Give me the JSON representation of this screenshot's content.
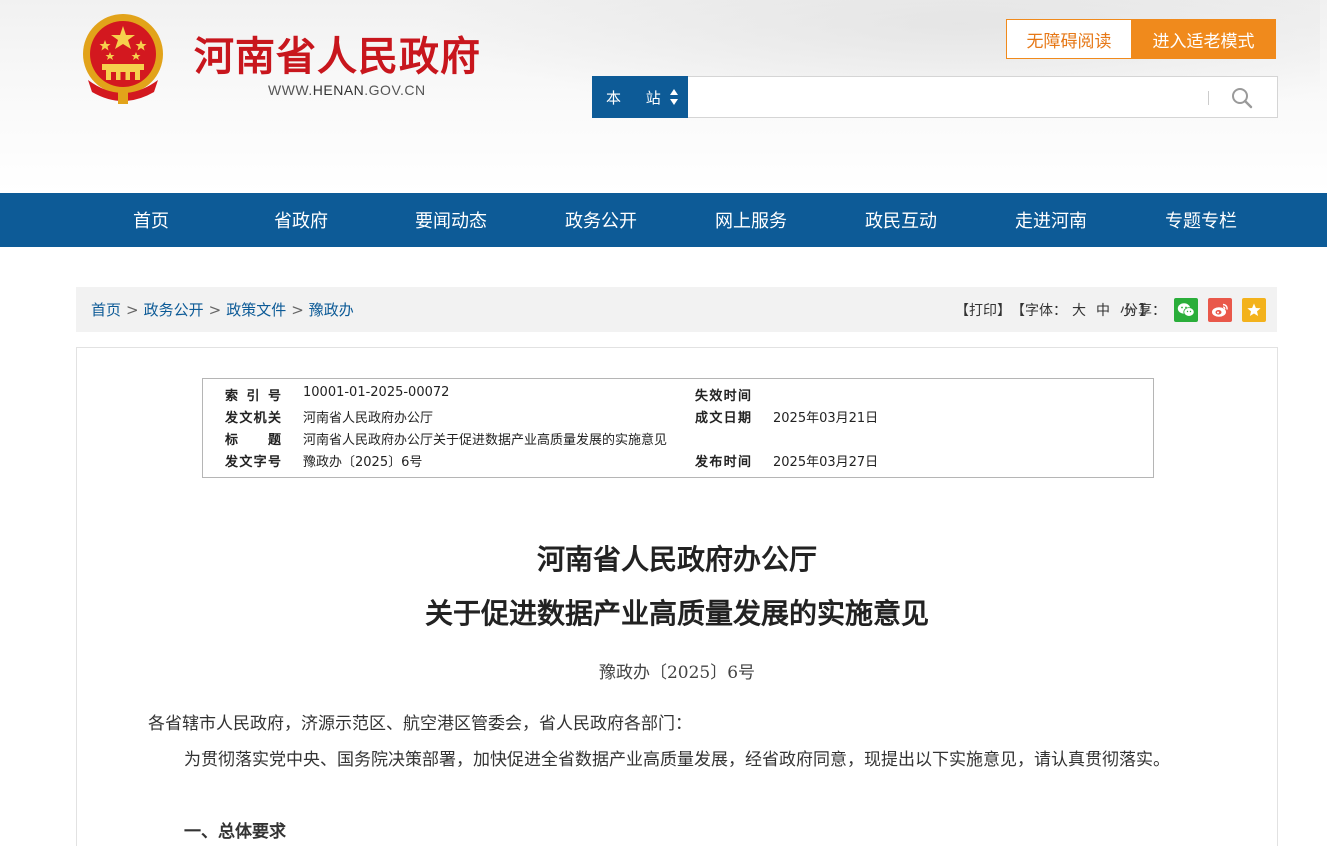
{
  "header": {
    "site_name": "河南省人民政府",
    "site_url_prefix": "WWW.",
    "site_url_domain": "HENAN",
    "site_url_suffix": ".GOV.CN",
    "accessibility_label": "无障碍阅读",
    "elder_mode_label": "进入适老模式",
    "search": {
      "scope_label": "本 站",
      "placeholder": "",
      "icon": "search-icon"
    }
  },
  "colors": {
    "brand_red": "#c8161d",
    "nav_blue": "#0d5b97",
    "accent_orange": "#f08a1c"
  },
  "nav": {
    "items": [
      "首页",
      "省政府",
      "要闻动态",
      "政务公开",
      "网上服务",
      "政民互动",
      "走进河南",
      "专题专栏"
    ]
  },
  "breadcrumb": {
    "items": [
      "首页",
      "政务公开",
      "政策文件",
      "豫政办"
    ],
    "separator": ">"
  },
  "tools": {
    "print": "【打印】",
    "font_prefix": "【字体：",
    "font_large": "大",
    "font_medium": "中",
    "font_small": "小",
    "font_suffix": "】",
    "share_label": "分享：",
    "share_icons": [
      "wechat-icon",
      "weibo-icon",
      "favorite-icon"
    ]
  },
  "meta": {
    "index_label": "索 引 号",
    "index_value": "10001-01-2025-00072",
    "expire_label": "失效时间",
    "expire_value": "",
    "issuer_label": "发文机关",
    "issuer_value": "河南省人民政府办公厅",
    "created_label": "成文日期",
    "created_value": "2025年03月21日",
    "title_label": "标　　题",
    "title_value": "河南省人民政府办公厅关于促进数据产业高质量发展的实施意见",
    "docno_label": "发文字号",
    "docno_value": "豫政办〔2025〕6号",
    "published_label": "发布时间",
    "published_value": "2025年03月27日"
  },
  "document": {
    "title_line1": "河南省人民政府办公厅",
    "title_line2": "关于促进数据产业高质量发展的实施意见",
    "number": "豫政办〔2025〕6号",
    "salutation": "各省辖市人民政府，济源示范区、航空港区管委会，省人民政府各部门：",
    "intro": "为贯彻落实党中央、国务院决策部署，加快促进全省数据产业高质量发展，经省政府同意，现提出以下实施意见，请认真贯彻落实。",
    "section1": "一、总体要求"
  }
}
